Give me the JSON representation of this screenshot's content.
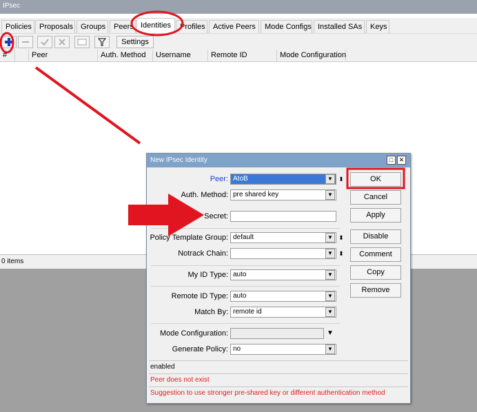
{
  "window": {
    "title": "IPsec"
  },
  "tabs": [
    {
      "label": "Policies"
    },
    {
      "label": "Proposals"
    },
    {
      "label": "Groups"
    },
    {
      "label": "Peers"
    },
    {
      "label": "Identities"
    },
    {
      "label": "Profiles"
    },
    {
      "label": "Active Peers"
    },
    {
      "label": "Mode Configs"
    },
    {
      "label": "Installed SAs"
    },
    {
      "label": "Keys"
    }
  ],
  "toolbar": {
    "add_icon": "plus-icon",
    "remove_icon": "minus-icon",
    "enable_icon": "check-icon",
    "disable_icon": "cross-icon",
    "comment_icon": "note-icon",
    "filter_icon": "filter-icon",
    "settings_label": "Settings"
  },
  "table": {
    "columns": [
      "#",
      "Peer",
      "Auth. Method",
      "Username",
      "Remote ID",
      "Mode Configuration"
    ]
  },
  "status": {
    "items": "0 items"
  },
  "dialog": {
    "title": "New IPsec Identity",
    "fields": {
      "peer": {
        "label": "Peer:",
        "value": "AtoB"
      },
      "auth_method": {
        "label": "Auth. Method:",
        "value": "pre shared key"
      },
      "secret": {
        "label": "Secret:",
        "value": ""
      },
      "policy_template_group": {
        "label": "Policy Template Group:",
        "value": "default"
      },
      "notrack_chain": {
        "label": "Notrack Chain:",
        "value": ""
      },
      "my_id_type": {
        "label": "My ID Type:",
        "value": "auto"
      },
      "remote_id_type": {
        "label": "Remote ID Type:",
        "value": "auto"
      },
      "match_by": {
        "label": "Match By:",
        "value": "remote id"
      },
      "mode_configuration": {
        "label": "Mode Configuration:",
        "value": ""
      },
      "generate_policy": {
        "label": "Generate Policy:",
        "value": "no"
      }
    },
    "buttons": {
      "ok": "OK",
      "cancel": "Cancel",
      "apply": "Apply",
      "disable": "Disable",
      "comment": "Comment",
      "copy": "Copy",
      "remove": "Remove"
    },
    "status": {
      "state": "enabled",
      "error": "Peer does not exist",
      "suggestion": "Suggestion to use stronger pre-shared key or different authentication method"
    }
  },
  "colors": {
    "annotation_red": "#e0151f",
    "dialog_title": "#7fa2c8",
    "peer_label_blue": "#1a3fd8",
    "selection_blue": "#3a7ad6"
  }
}
